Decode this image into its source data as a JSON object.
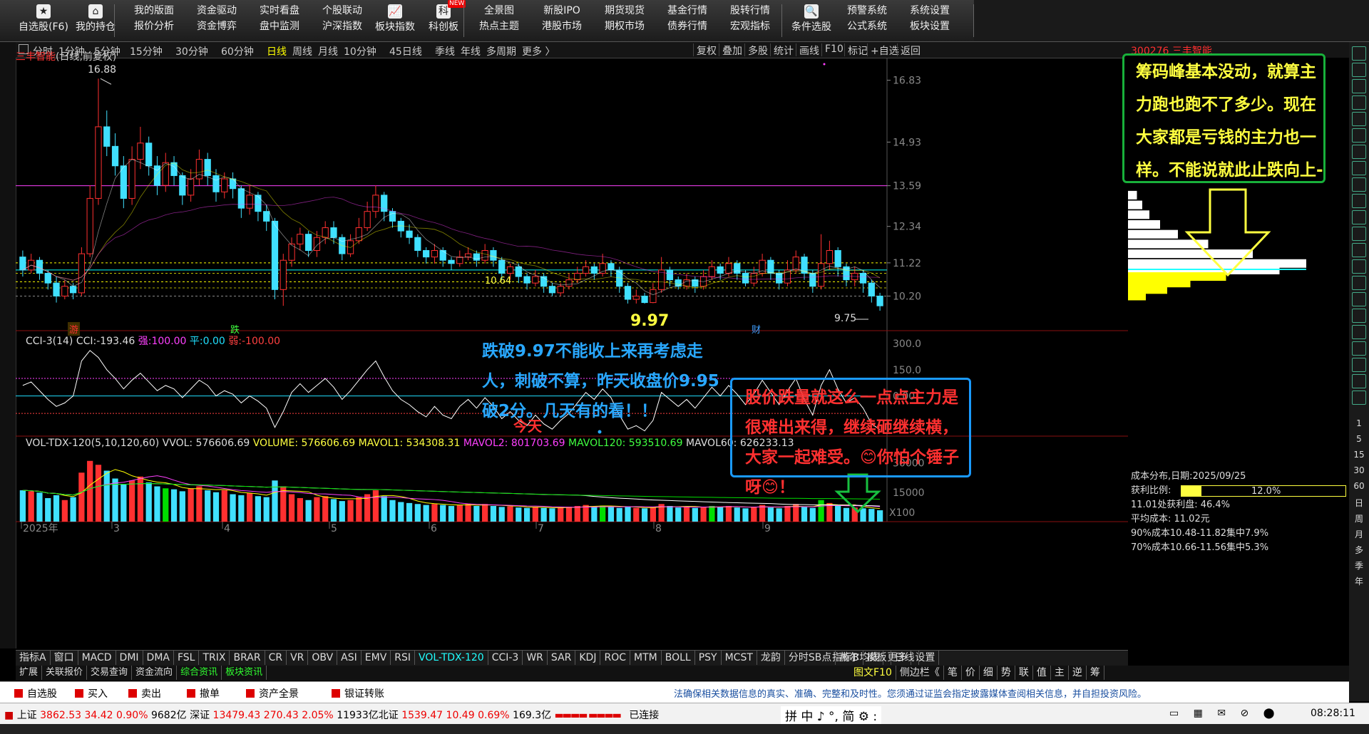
{
  "toolbar": {
    "items": [
      {
        "top": "自选股(F6)",
        "icon": "star-icon"
      },
      {
        "top": "我的持仓",
        "icon": "home-icon"
      },
      {
        "top": "我的版面",
        "bottom": "报价分析"
      },
      {
        "top": "资金驱动",
        "bottom": "资金博弈"
      },
      {
        "top": "实时看盘",
        "bottom": "盘中监测"
      },
      {
        "top": "个股联动",
        "bottom": "沪深指数"
      },
      {
        "top": "板块指数",
        "icon": "chart-line-icon"
      },
      {
        "top": "科创板",
        "icon": "kechuang-icon",
        "badge": "NEW"
      },
      {
        "top": "全景图",
        "bottom": "热点主题"
      },
      {
        "top": "新股IPO",
        "bottom": "港股市场"
      },
      {
        "top": "期货现货",
        "bottom": "期权市场"
      },
      {
        "top": "基金行情",
        "bottom": "债券行情"
      },
      {
        "top": "股转行情",
        "bottom": "宏观指标"
      },
      {
        "top": "条件选股",
        "icon": "search-chart-icon"
      },
      {
        "top": "预警系统",
        "bottom": "公式系统"
      },
      {
        "top": "系统设置",
        "bottom": "板块设置"
      }
    ]
  },
  "period_bar": {
    "items": [
      "分时",
      "1分钟",
      "5分钟",
      "15分钟",
      "30分钟",
      "60分钟",
      "日线",
      "周线",
      "月线",
      "10分钟",
      "45日线",
      "季线",
      "年线",
      "多周期",
      "更多 〉"
    ],
    "active": "日线",
    "right_items": [
      "复权",
      "叠加",
      "多股",
      "统计",
      "画线",
      "F10",
      "标记",
      "+自选",
      "返回"
    ]
  },
  "stock": {
    "code_name": "300276 三丰智能",
    "title": "三丰智能",
    "subtitle": "(日线,前复权)",
    "high_label": "16.88",
    "low_label": "9.97",
    "last_label": "9.75",
    "mid_label": "10.64",
    "markers": [
      "游",
      "跌",
      "财"
    ]
  },
  "cci": {
    "name": "CCI-3(14)",
    "value_label": "CCI:",
    "value": "-193.46",
    "strong_label": "强:",
    "strong": "100.00",
    "flat_label": "平:",
    "flat": "0.00",
    "weak_label": "弱:",
    "weak": "-100.00",
    "ticks": [
      "300.0",
      "150.0",
      "0.00"
    ]
  },
  "volume": {
    "name": "VOL-TDX-120(5,10,120,60)",
    "vvol": "VVOL: 576606.69",
    "volume": "VOLUME: 576606.69",
    "mavol1": "MAVOL1: 534308.31",
    "mavol2": "MAVOL2: 801703.69",
    "mavol120": "MAVOL120: 593510.69",
    "mavol60": "MAVOL60: 626233.13",
    "ticks": [
      "30000",
      "15000"
    ],
    "unit": "X100"
  },
  "annotations": {
    "green_box": "筹码峰基本没动，就算主力跑也跑不了多少。现在大家都是亏钱的主力也一样。不能说就此止跌向上--概率很大。",
    "blue_note": "跌破9.97不能收上来再考虑走人，刺破不算，昨天收盘价9.95破2分。几天有的看！！",
    "today": "今天",
    "red_box": "股价跌量就这么一点点主力是很难出来得，继续砸继续横，大家一起难受。😊你怕个锤子呀😊！"
  },
  "chip": {
    "date_label": "成本分布,日期:",
    "date": "2025/09/25",
    "profit_label": "获利比例:",
    "profit": "12.0%",
    "profit_ratio": 0.12,
    "line1": "11.01处获利盘: 46.4%",
    "line2": "平均成本: 11.02元",
    "line3": "90%成本10.48-11.82集中7.9%",
    "line4": "70%成本10.66-11.56集中5.3%"
  },
  "ind_tabs": [
    "指标A",
    "窗口",
    "MACD",
    "DMI",
    "DMA",
    "FSL",
    "TRIX",
    "BRAR",
    "CR",
    "VR",
    "OBV",
    "ASI",
    "EMV",
    "RSI",
    "VOL-TDX-120",
    "CCI-3",
    "WR",
    "SAR",
    "KDJ",
    "ROC",
    "MTM",
    "BOLL",
    "PSY",
    "MCST",
    "龙韵",
    "分时SB点",
    "赫尔均线",
    "更多",
    "设置"
  ],
  "ind_tabs_active": "VOL-TDX-120",
  "ind_tabs_right": [
    "指标B",
    "模板",
    "日线"
  ],
  "ext_tabs": [
    "扩展",
    "关联报价",
    "交易查询",
    "资金流向",
    "综合资讯",
    "板块资讯"
  ],
  "ext_tabs_right": [
    "图文F10",
    "侧边栏《",
    "笔",
    "价",
    "细",
    "势",
    "联",
    "值",
    "主",
    "逆",
    "筹"
  ],
  "trade_bar": {
    "items": [
      "自选股",
      "买入",
      "卖出",
      "撤单",
      "资产全景",
      "银证转账"
    ],
    "disclaimer": "法确保相关数据信息的真实、准确、完整和及时性。您须通过证监会指定披露媒体查阅相关信息，并自担投资风险。"
  },
  "status_bar": {
    "sh_label": "上证",
    "sh": "3862.53",
    "sh_chg": "34.42",
    "sh_pct": "0.90%",
    "sh_amt": "9682亿",
    "sz_label": "深证",
    "sz": "13479.43",
    "sz_chg": "270.43",
    "sz_pct": "2.05%",
    "sz_amt": "11933亿",
    "bz_label": "北证",
    "bz": "1539.47",
    "bz_chg": "10.49",
    "bz_pct": "0.69%",
    "bz_amt": "169.3亿",
    "connected": "已连接",
    "ime": "拼 中 ♪ °, 简 ⚙ :",
    "time": "08:28:11"
  },
  "sidebar_numbers": [
    "1",
    "5",
    "15",
    "30",
    "60",
    "日",
    "周",
    "月",
    "多",
    "季",
    "年"
  ],
  "colors": {
    "up": "#ff3030",
    "down": "#40e0ff",
    "ma_magenta": "#ff40ff",
    "ma_yellow": "#ffff00",
    "ma_green": "#00dd00",
    "ma_white": "#ffffff"
  },
  "chart_data": {
    "type": "candlestick",
    "price_axis_ticks": [
      16.83,
      14.93,
      13.59,
      12.34,
      11.22,
      10.2
    ],
    "ylim": [
      9.4,
      17.5
    ],
    "x_month_labels": [
      "2025年",
      "3",
      "4",
      "5",
      "6",
      "7",
      "8",
      "9"
    ],
    "bars": [
      [
        11.4,
        11.0,
        11.6,
        10.8
      ],
      [
        11.0,
        11.3,
        11.5,
        10.9
      ],
      [
        11.3,
        10.9,
        11.4,
        10.7
      ],
      [
        10.9,
        10.6,
        11.0,
        10.4
      ],
      [
        10.6,
        10.2,
        10.8,
        10.0
      ],
      [
        10.2,
        10.5,
        10.7,
        10.1
      ],
      [
        10.5,
        10.3,
        10.6,
        10.1
      ],
      [
        10.3,
        11.5,
        11.7,
        10.2
      ],
      [
        11.5,
        13.2,
        13.6,
        11.4
      ],
      [
        13.2,
        15.4,
        16.88,
        13.0
      ],
      [
        15.4,
        14.8,
        15.9,
        14.5
      ],
      [
        14.8,
        14.2,
        15.2,
        13.9
      ],
      [
        14.2,
        13.2,
        14.5,
        12.9
      ],
      [
        13.2,
        14.4,
        14.8,
        13.0
      ],
      [
        14.4,
        14.9,
        15.4,
        14.1
      ],
      [
        14.9,
        14.2,
        15.1,
        13.9
      ],
      [
        14.2,
        13.6,
        14.5,
        13.3
      ],
      [
        13.6,
        14.3,
        14.6,
        13.4
      ],
      [
        14.3,
        13.9,
        14.5,
        13.6
      ],
      [
        13.9,
        13.3,
        14.0,
        13.0
      ],
      [
        13.3,
        13.8,
        14.1,
        13.1
      ],
      [
        13.8,
        14.4,
        14.7,
        13.6
      ],
      [
        14.4,
        13.9,
        14.6,
        13.6
      ],
      [
        13.9,
        13.4,
        14.1,
        13.1
      ],
      [
        13.4,
        13.8,
        14.0,
        13.2
      ],
      [
        13.8,
        13.5,
        14.0,
        13.2
      ],
      [
        13.5,
        12.9,
        13.6,
        12.6
      ],
      [
        12.9,
        13.3,
        13.6,
        12.7
      ],
      [
        13.3,
        12.8,
        13.4,
        12.5
      ],
      [
        12.8,
        12.5,
        13.0,
        12.2
      ],
      [
        12.5,
        10.4,
        12.6,
        10.1
      ],
      [
        10.4,
        11.3,
        11.5,
        9.9
      ],
      [
        11.3,
        11.8,
        12.0,
        11.1
      ],
      [
        11.8,
        12.1,
        12.3,
        11.6
      ],
      [
        12.1,
        11.6,
        12.2,
        11.4
      ],
      [
        11.6,
        12.0,
        12.2,
        11.4
      ],
      [
        12.0,
        12.3,
        12.5,
        11.8
      ],
      [
        12.3,
        12.0,
        12.5,
        11.8
      ],
      [
        12.0,
        11.5,
        12.1,
        11.3
      ],
      [
        11.5,
        11.9,
        12.1,
        11.4
      ],
      [
        11.9,
        12.3,
        12.6,
        11.8
      ],
      [
        12.3,
        12.8,
        13.1,
        12.2
      ],
      [
        12.8,
        13.3,
        13.6,
        12.6
      ],
      [
        13.3,
        12.8,
        13.4,
        12.5
      ],
      [
        12.8,
        12.5,
        12.9,
        12.3
      ],
      [
        12.5,
        12.2,
        12.6,
        12.0
      ],
      [
        12.2,
        12.0,
        12.4,
        11.8
      ],
      [
        12.0,
        11.6,
        12.1,
        11.4
      ],
      [
        11.6,
        11.4,
        11.7,
        11.2
      ],
      [
        11.4,
        11.6,
        11.8,
        11.2
      ],
      [
        11.6,
        11.3,
        11.7,
        11.1
      ],
      [
        11.3,
        11.2,
        11.4,
        11.0
      ],
      [
        11.2,
        11.4,
        11.6,
        11.1
      ],
      [
        11.4,
        11.5,
        11.7,
        11.3
      ],
      [
        11.5,
        11.3,
        11.6,
        11.1
      ],
      [
        11.3,
        11.6,
        11.8,
        11.2
      ],
      [
        11.6,
        11.3,
        11.7,
        11.1
      ],
      [
        11.3,
        10.9,
        11.4,
        10.7
      ],
      [
        10.9,
        11.1,
        11.2,
        10.7
      ],
      [
        11.1,
        10.8,
        11.2,
        10.6
      ],
      [
        10.8,
        10.6,
        10.9,
        10.4
      ],
      [
        10.6,
        10.8,
        11.0,
        10.5
      ],
      [
        10.8,
        10.5,
        10.9,
        10.3
      ],
      [
        10.5,
        10.3,
        10.6,
        10.2
      ],
      [
        10.3,
        10.5,
        10.6,
        10.2
      ],
      [
        10.5,
        10.7,
        10.9,
        10.4
      ],
      [
        10.7,
        10.9,
        11.1,
        10.6
      ],
      [
        10.9,
        11.1,
        11.3,
        10.8
      ],
      [
        11.1,
        10.9,
        11.2,
        10.7
      ],
      [
        10.9,
        11.2,
        11.5,
        10.8
      ],
      [
        11.2,
        11.0,
        11.3,
        10.8
      ],
      [
        11.0,
        10.5,
        11.1,
        10.3
      ],
      [
        10.5,
        10.1,
        10.6,
        9.97
      ],
      [
        10.1,
        10.2,
        10.4,
        9.97
      ],
      [
        10.2,
        10.0,
        10.3,
        9.97
      ],
      [
        10.0,
        10.4,
        10.6,
        9.98
      ],
      [
        10.4,
        11.0,
        11.4,
        10.3
      ],
      [
        11.0,
        10.7,
        11.1,
        10.5
      ],
      [
        10.7,
        10.5,
        10.8,
        10.4
      ],
      [
        10.5,
        10.7,
        10.9,
        10.4
      ],
      [
        10.7,
        10.5,
        10.8,
        10.3
      ],
      [
        10.5,
        10.8,
        11.0,
        10.4
      ],
      [
        10.8,
        11.1,
        11.3,
        10.7
      ],
      [
        11.1,
        10.9,
        11.2,
        10.7
      ],
      [
        10.9,
        11.2,
        11.4,
        10.8
      ],
      [
        11.2,
        10.9,
        11.3,
        10.7
      ],
      [
        10.9,
        10.6,
        11.0,
        10.5
      ],
      [
        10.6,
        10.9,
        11.1,
        10.5
      ],
      [
        10.9,
        11.3,
        11.5,
        10.8
      ],
      [
        11.3,
        10.9,
        11.4,
        10.7
      ],
      [
        10.9,
        10.6,
        11.0,
        10.4
      ],
      [
        10.6,
        11.0,
        11.3,
        10.5
      ],
      [
        11.0,
        11.4,
        11.6,
        10.9
      ],
      [
        11.4,
        10.9,
        11.5,
        10.7
      ],
      [
        10.9,
        10.5,
        11.0,
        10.3
      ],
      [
        10.5,
        11.2,
        12.1,
        10.4
      ],
      [
        11.2,
        11.6,
        11.9,
        11.0
      ],
      [
        11.6,
        11.1,
        11.7,
        10.8
      ],
      [
        11.1,
        10.7,
        11.2,
        10.5
      ],
      [
        10.7,
        10.9,
        11.1,
        10.5
      ],
      [
        10.9,
        10.6,
        11.0,
        10.3
      ],
      [
        10.6,
        10.2,
        10.7,
        10.0
      ],
      [
        10.2,
        9.9,
        10.3,
        9.75
      ]
    ],
    "cci_values": [
      60,
      80,
      30,
      -20,
      -60,
      -40,
      0,
      200,
      260,
      220,
      150,
      100,
      40,
      90,
      130,
      80,
      30,
      60,
      40,
      -10,
      40,
      90,
      60,
      0,
      30,
      10,
      -40,
      0,
      -30,
      -70,
      -180,
      -90,
      20,
      70,
      20,
      60,
      100,
      50,
      -20,
      30,
      90,
      150,
      200,
      110,
      30,
      -20,
      -50,
      -90,
      -120,
      -60,
      -110,
      -130,
      -60,
      -20,
      -70,
      -10,
      -60,
      -130,
      -90,
      -140,
      -170,
      -110,
      -160,
      -190,
      -140,
      -100,
      -40,
      20,
      -20,
      40,
      -10,
      -110,
      -190,
      -170,
      -200,
      -140,
      20,
      -20,
      -60,
      -20,
      -70,
      -10,
      50,
      0,
      60,
      10,
      -50,
      10,
      90,
      20,
      -50,
      30,
      100,
      -20,
      -110,
      60,
      150,
      40,
      -40,
      -10,
      -70,
      -160,
      -193.46
    ],
    "volume_values": [
      16000,
      15500,
      14800,
      12000,
      13500,
      11000,
      12500,
      25000,
      31000,
      29000,
      26000,
      22000,
      19000,
      21000,
      23000,
      20000,
      18000,
      17000,
      16500,
      15500,
      17000,
      18000,
      16000,
      15000,
      16000,
      14000,
      13500,
      14500,
      13000,
      12500,
      21000,
      18000,
      14000,
      12000,
      11000,
      12500,
      13000,
      11500,
      10500,
      11000,
      12500,
      14000,
      16000,
      13000,
      11000,
      10000,
      9500,
      9000,
      8500,
      9000,
      8500,
      8000,
      8500,
      9000,
      8000,
      9000,
      8000,
      7500,
      7800,
      7200,
      7000,
      7600,
      7000,
      6800,
      7200,
      7600,
      8000,
      8500,
      7800,
      8200,
      7500,
      7000,
      7600,
      7000,
      6800,
      7200,
      9000,
      8000,
      7200,
      7400,
      7000,
      7500,
      8000,
      7400,
      8000,
      7200,
      6800,
      7500,
      8500,
      7200,
      6800,
      8000,
      9000,
      7500,
      7000,
      11000,
      9500,
      8000,
      7000,
      7200,
      6800,
      6500,
      5800
    ],
    "chip_levels": [
      13.3,
      13.0,
      12.7,
      12.4,
      12.1,
      11.8,
      11.5,
      11.2,
      11.0,
      10.8,
      10.6,
      10.4,
      10.2
    ],
    "chip_weights": [
      0.05,
      0.08,
      0.12,
      0.18,
      0.28,
      0.45,
      0.7,
      1.0,
      0.85,
      0.55,
      0.35,
      0.22,
      0.1
    ],
    "ref_lines": [
      11.22,
      11.0,
      10.9,
      10.64,
      10.45,
      10.2,
      13.59
    ]
  }
}
